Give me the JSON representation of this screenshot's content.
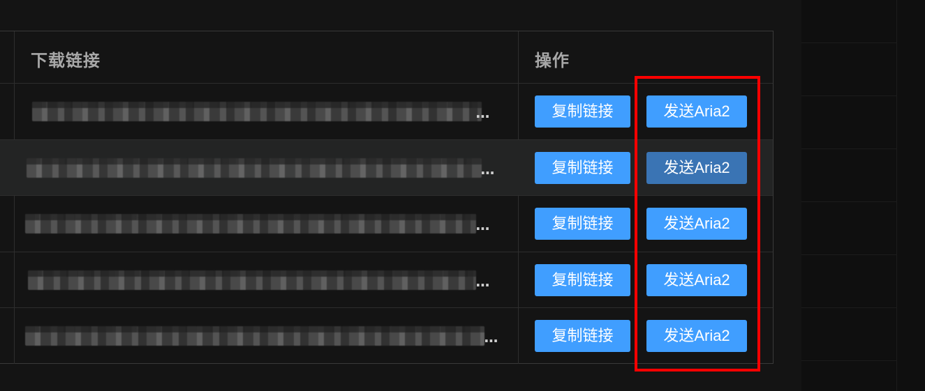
{
  "table": {
    "headers": {
      "link": "下载链接",
      "actions": "操作"
    },
    "rows": [
      {
        "ellipsis": "...",
        "copy_label": "复制链接",
        "send_label": "发送Aria2"
      },
      {
        "ellipsis": "...",
        "copy_label": "复制链接",
        "send_label": "发送Aria2"
      },
      {
        "ellipsis": "...",
        "copy_label": "复制链接",
        "send_label": "发送Aria2"
      },
      {
        "ellipsis": "...",
        "copy_label": "复制链接",
        "send_label": "发送Aria2"
      },
      {
        "ellipsis": "...",
        "copy_label": "复制链接",
        "send_label": "发送Aria2"
      }
    ]
  },
  "colors": {
    "primary_button": "#409eff",
    "pressed_button": "#3a74b4",
    "highlight_box": "#ff0000",
    "background": "#141414"
  }
}
